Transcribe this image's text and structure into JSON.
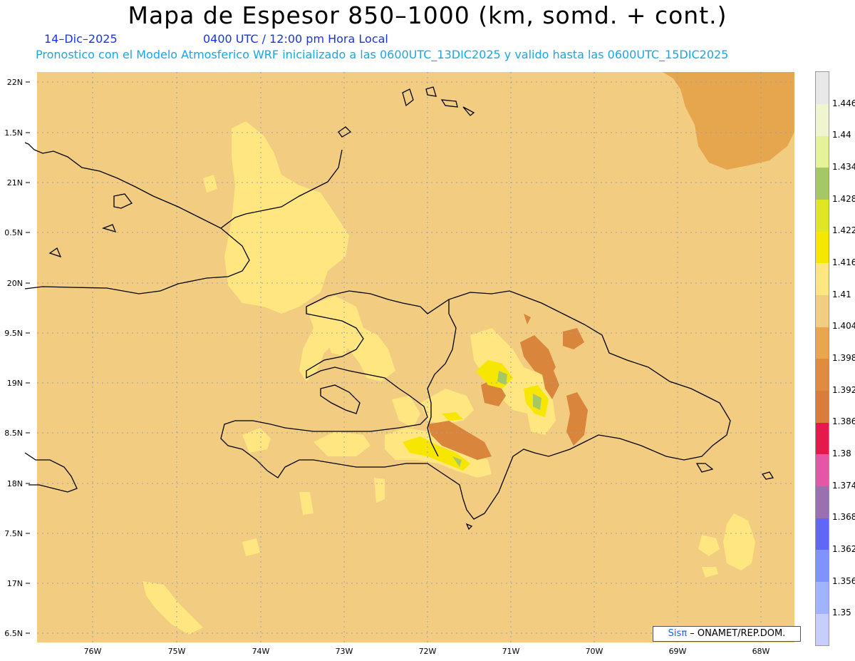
{
  "header": {
    "title": "Mapa de Espesor 850–1000 (km, somd. + cont.)",
    "date": "14–Dic–2025",
    "time": "0400 UTC / 12:00 pm Hora Local",
    "forecast": "Pronostico con el Modelo Atmosferico WRF inicializado a las 0600UTC_13DIC2025 y valido hasta las  0600UTC_15DIC2025"
  },
  "map": {
    "lat_labels": [
      "22N",
      "1.5N",
      "21N",
      "0.5N",
      "20N",
      "9.5N",
      "19N",
      "8.5N",
      "18N",
      "7.5N",
      "17N",
      "6.5N"
    ],
    "lon_labels": [
      "76W",
      "75W",
      "74W",
      "73W",
      "72W",
      "71W",
      "70W",
      "69W",
      "68W"
    ],
    "colors": {
      "background": "#f2cc80",
      "light": "#ffe680",
      "orange": "#e6a64d",
      "dark": "#d9853c",
      "yellow": "#f0e000",
      "green": "#a6c766",
      "coast": "#000000",
      "grid": "#9aa0b4"
    }
  },
  "colorbar": {
    "levels": [
      "1.35",
      "1.356",
      "1.362",
      "1.368",
      "1.374",
      "1.38",
      "1.386",
      "1.392",
      "1.398",
      "1.404",
      "1.41",
      "1.416",
      "1.422",
      "1.428",
      "1.434",
      "1.44",
      "1.446"
    ],
    "colors": [
      "#c7cdff",
      "#9fb3ff",
      "#7f93ff",
      "#6066f5",
      "#9a70b0",
      "#e655a6",
      "#e6194d",
      "#d97c3c",
      "#e08c40",
      "#e8a64d",
      "#f2cc80",
      "#ffe680",
      "#f7e600",
      "#e0e624",
      "#a6c766",
      "#e6f29a",
      "#f0f5d0",
      "#e8e8e8"
    ]
  },
  "credit": {
    "prefix": "Sis",
    "pi": "π",
    "suffix": "– ONAMET/REP.DOM."
  }
}
